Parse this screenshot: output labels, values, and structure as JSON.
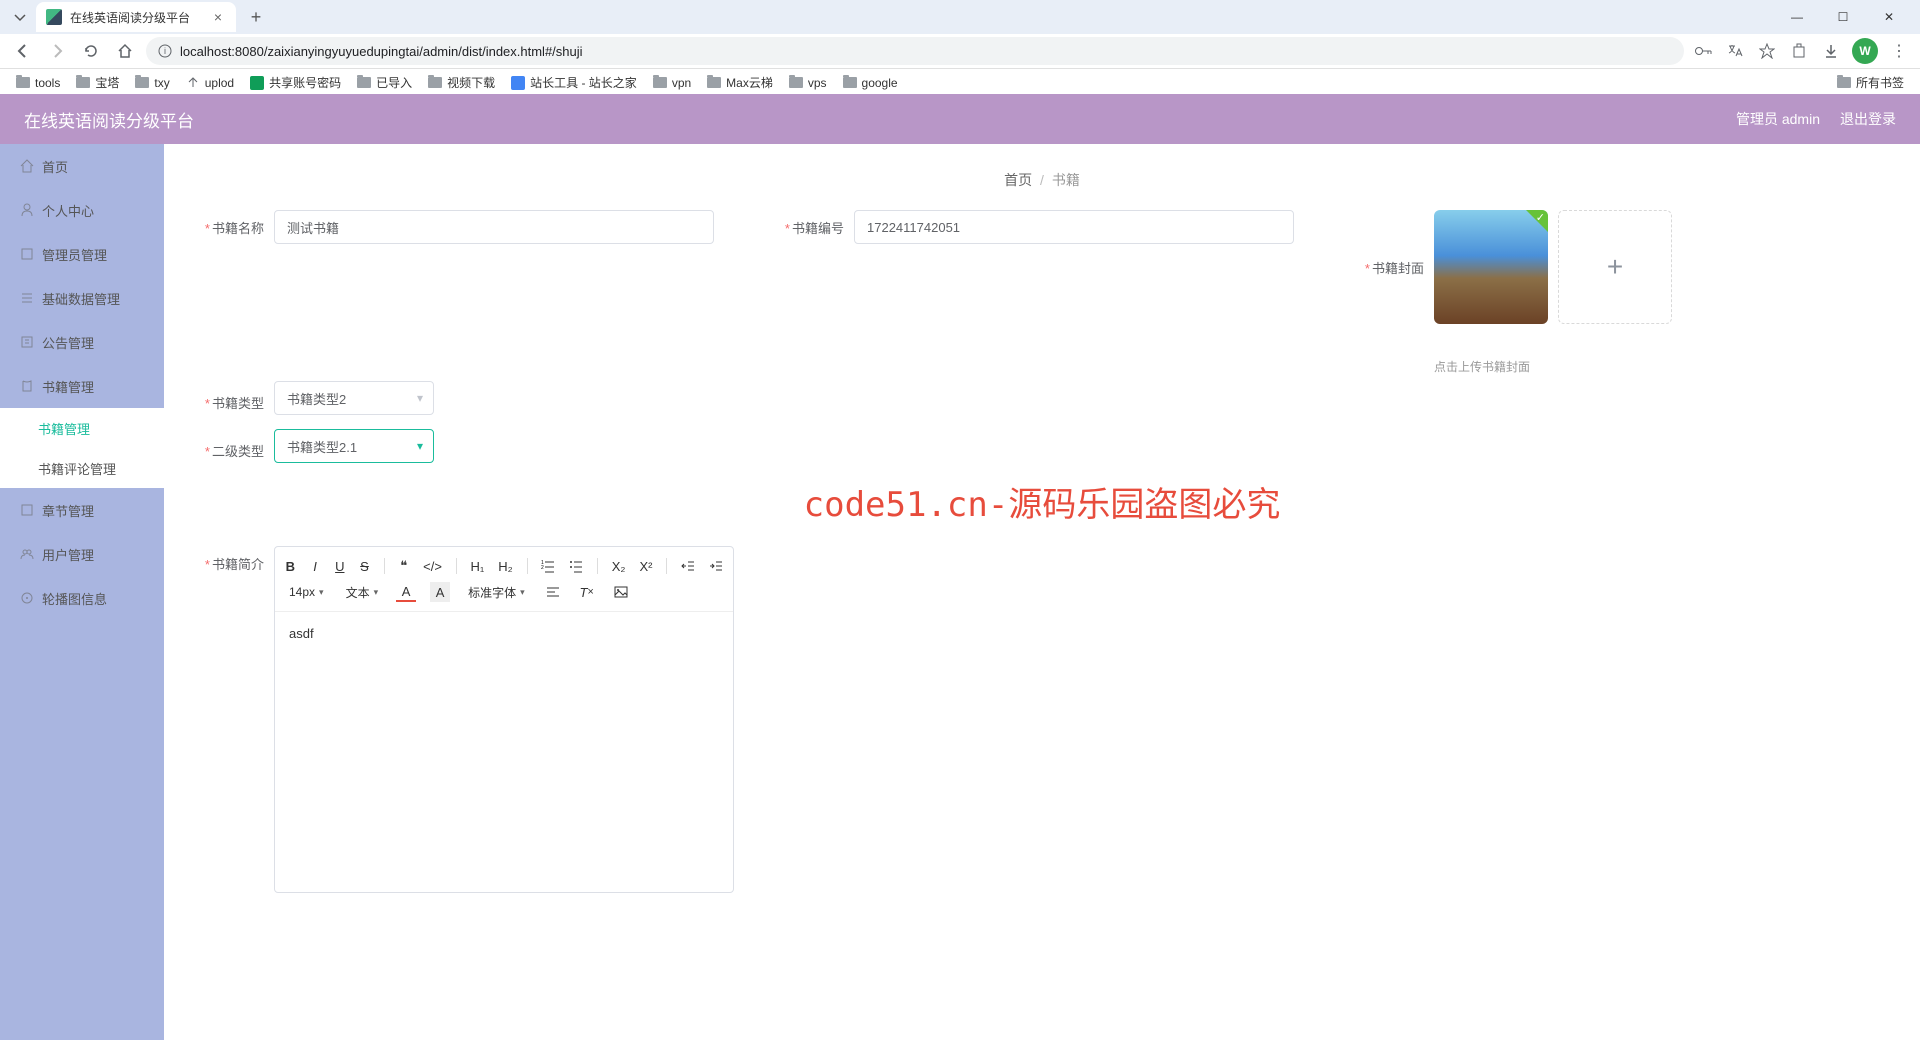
{
  "browser": {
    "tab_title": "在线英语阅读分级平台",
    "url": "localhost:8080/zaixianyingyuyuedupingtai/admin/dist/index.html#/shuji",
    "avatar_letter": "W",
    "bookmarks": [
      "tools",
      "宝塔",
      "txy",
      "uplod",
      "共享账号密码",
      "已导入",
      "视频下载",
      "站长工具 - 站长之家",
      "vpn",
      "Max云梯",
      "vps",
      "google"
    ],
    "all_bookmarks": "所有书签"
  },
  "header": {
    "title": "在线英语阅读分级平台",
    "user_info": "管理员 admin",
    "logout": "退出登录"
  },
  "sidebar": {
    "items": [
      {
        "label": "首页",
        "icon": "home"
      },
      {
        "label": "个人中心",
        "icon": "user"
      },
      {
        "label": "管理员管理",
        "icon": "admin"
      },
      {
        "label": "基础数据管理",
        "icon": "data"
      },
      {
        "label": "公告管理",
        "icon": "notice"
      },
      {
        "label": "书籍管理",
        "icon": "book"
      },
      {
        "label": "书籍管理",
        "sub": true,
        "active": true
      },
      {
        "label": "书籍评论管理",
        "sub": true
      },
      {
        "label": "章节管理",
        "icon": "chapter"
      },
      {
        "label": "用户管理",
        "icon": "users"
      },
      {
        "label": "轮播图信息",
        "icon": "carousel"
      }
    ]
  },
  "breadcrumb": {
    "home": "首页",
    "current": "书籍"
  },
  "form": {
    "book_name_label": "书籍名称",
    "book_name_value": "测试书籍",
    "book_no_label": "书籍编号",
    "book_no_value": "1722411742051",
    "cover_label": "书籍封面",
    "upload_hint": "点击上传书籍封面",
    "type_label": "书籍类型",
    "type_value": "书籍类型2",
    "subtype_label": "二级类型",
    "subtype_value": "书籍类型2.1",
    "intro_label": "书籍简介",
    "intro_content": "asdf"
  },
  "editor": {
    "font_size": "14px",
    "text_style": "文本",
    "font_family": "标准字体"
  },
  "watermark": "code51.cn-源码乐园盗图必究"
}
